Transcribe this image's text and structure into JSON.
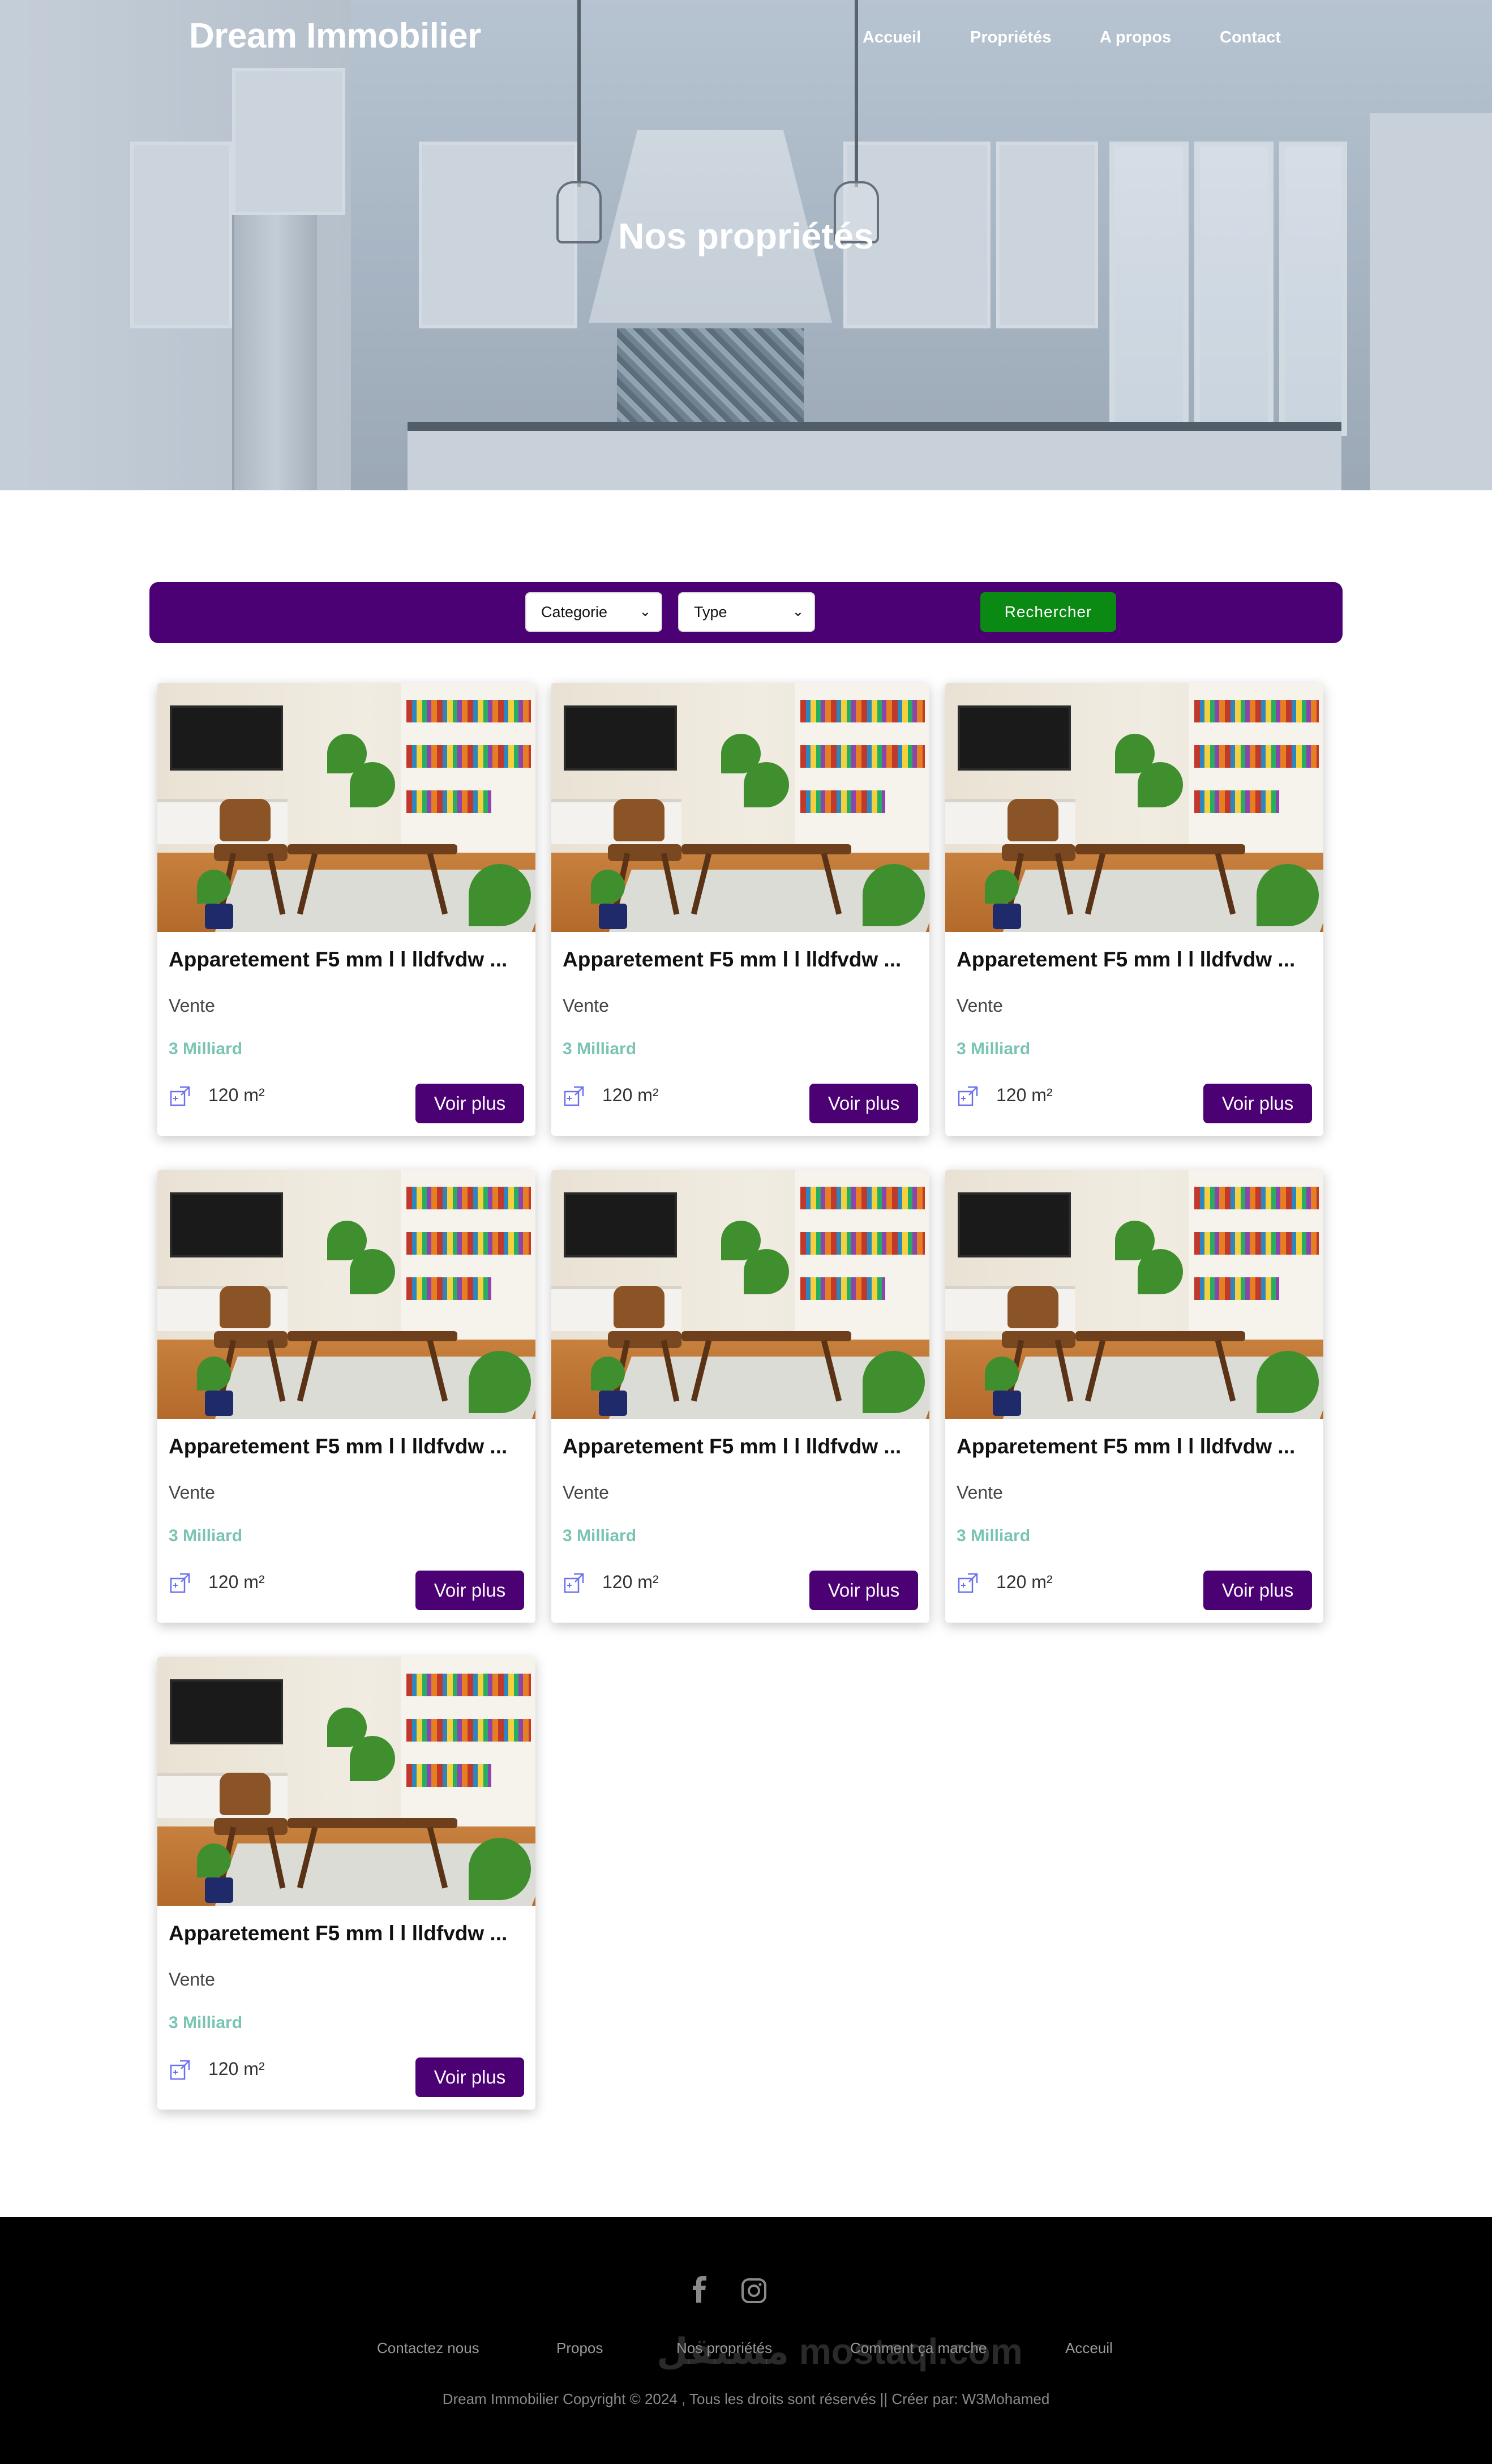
{
  "header": {
    "brand": "Dream Immobilier",
    "nav": [
      "Accueil",
      "Propriétés",
      "A propos",
      "Contact"
    ],
    "hero_title": "Nos propriétés"
  },
  "filters": {
    "category_value": "Categorie",
    "type_value": "Type",
    "search_label": "Rechercher"
  },
  "colors": {
    "accent_purple": "#4b0073",
    "search_green": "#0a8a12",
    "price_teal": "#7ac4b4",
    "footer_bg": "#000000"
  },
  "properties": [
    {
      "title": "Apparetement F5 mm l l lldfvdw ...",
      "type": "Vente",
      "price": "3 Milliard",
      "area": "120 m²",
      "button": "Voir plus"
    },
    {
      "title": "Apparetement F5 mm l l lldfvdw ...",
      "type": "Vente",
      "price": "3 Milliard",
      "area": "120 m²",
      "button": "Voir plus"
    },
    {
      "title": "Apparetement F5 mm l l lldfvdw ...",
      "type": "Vente",
      "price": "3 Milliard",
      "area": "120 m²",
      "button": "Voir plus"
    },
    {
      "title": "Apparetement F5 mm l l lldfvdw ...",
      "type": "Vente",
      "price": "3 Milliard",
      "area": "120 m²",
      "button": "Voir plus"
    },
    {
      "title": "Apparetement F5 mm l l lldfvdw ...",
      "type": "Vente",
      "price": "3 Milliard",
      "area": "120 m²",
      "button": "Voir plus"
    },
    {
      "title": "Apparetement F5 mm l l lldfvdw ...",
      "type": "Vente",
      "price": "3 Milliard",
      "area": "120 m²",
      "button": "Voir plus"
    },
    {
      "title": "Apparetement F5 mm l l lldfvdw ...",
      "type": "Vente",
      "price": "3 Milliard",
      "area": "120 m²",
      "button": "Voir plus"
    }
  ],
  "footer": {
    "social": [
      "facebook-icon",
      "instagram-icon"
    ],
    "links": [
      "Contactez nous",
      "Propos",
      "Nos propriétés",
      "Comment ça marche",
      "Acceuil"
    ],
    "copyright": "Dream Immobilier Copyright © 2024 , Tous les droits sont réservés || Créer par: W3Mohamed",
    "watermark": "مستقل mostaql.com"
  }
}
